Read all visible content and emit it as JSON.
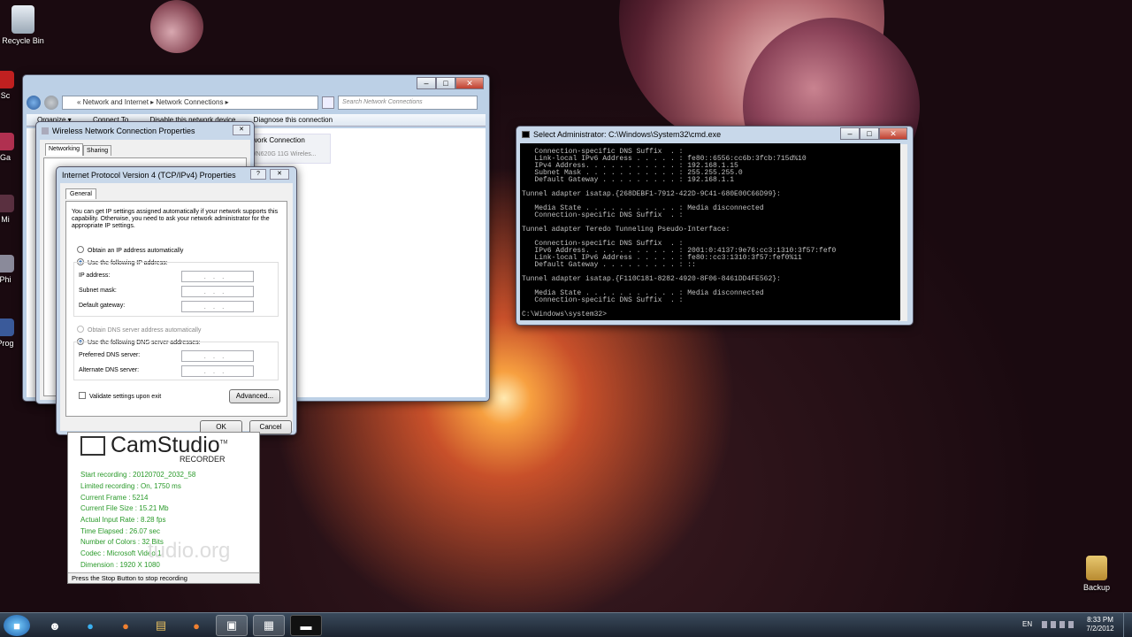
{
  "desktop": {
    "recycle_bin": "Recycle Bin",
    "backup": "Backup",
    "side_labels": [
      "Sc",
      "Ga",
      "Mi",
      "Phi",
      "Prog"
    ]
  },
  "explorer": {
    "breadcrumb": [
      "Network and Internet",
      "Network Connections"
    ],
    "search_placeholder": "Search Network Connections",
    "toolbar": [
      "Organize ▾",
      "Connect To",
      "Disable this network device",
      "Diagnose this connection"
    ],
    "item_name": "twork Connection",
    "item_detail": "WN620G 11G Wireles..."
  },
  "wnc_props": {
    "title": "Wireless Network Connection Properties",
    "tabs": [
      "Networking",
      "Sharing"
    ]
  },
  "ipv4": {
    "title": "Internet Protocol Version 4 (TCP/IPv4) Properties",
    "tab": "General",
    "intro": "You can get IP settings assigned automatically if your network supports this capability. Otherwise, you need to ask your network administrator for the appropriate IP settings.",
    "obtain_ip": "Obtain an IP address automatically",
    "use_ip": "Use the following IP address:",
    "ip_label": "IP address:",
    "mask_label": "Subnet mask:",
    "gateway_label": "Default gateway:",
    "obtain_dns": "Obtain DNS server address automatically",
    "use_dns": "Use the following DNS server addresses:",
    "pref_dns": "Preferred DNS server:",
    "alt_dns": "Alternate DNS server:",
    "validate": "Validate settings upon exit",
    "advanced": "Advanced...",
    "ok": "OK",
    "cancel": "Cancel",
    "field_dots": "...",
    "close_glyph": "✕",
    "help_glyph": "?"
  },
  "cmd": {
    "title": "Select Administrator: C:\\Windows\\System32\\cmd.exe",
    "output": "   Connection-specific DNS Suffix  . :\n   Link-local IPv6 Address . . . . . : fe80::6556:cc6b:3fcb:715d%10\n   IPv4 Address. . . . . . . . . . . : 192.168.1.15\n   Subnet Mask . . . . . . . . . . . : 255.255.255.0\n   Default Gateway . . . . . . . . . : 192.168.1.1\n\nTunnel adapter isatap.{268DEBF1-7912-422D-9C41-680E00C66D99}:\n\n   Media State . . . . . . . . . . . : Media disconnected\n   Connection-specific DNS Suffix  . :\n\nTunnel adapter Teredo Tunneling Pseudo-Interface:\n\n   Connection-specific DNS Suffix  . :\n   IPv6 Address. . . . . . . . . . . : 2001:0:4137:9e76:cc3:1310:3f57:fef0\n   Link-local IPv6 Address . . . . . : fe80::cc3:1310:3f57:fef0%11\n   Default Gateway . . . . . . . . . : ::\n\nTunnel adapter isatap.{F110C181-8282-4920-8F06-8461DD4FE562}:\n\n   Media State . . . . . . . . . . . : Media disconnected\n   Connection-specific DNS Suffix  . :\n\nC:\\Windows\\system32>"
  },
  "camstudio": {
    "logo": "CamStudio",
    "sub": "RECORDER",
    "tm": "TM",
    "lines": [
      "Start recording : 20120702_2032_58",
      "Limited recording : On, 1750 ms",
      "Current Frame : 5214",
      "Current File Size : 15.21 Mb",
      "Actual Input Rate : 8.28 fps",
      "Time Elapsed : 26.07 sec",
      "Number of Colors : 32 Bits",
      "Codec : Microsoft Video 1",
      "Dimension : 1920 X 1080"
    ],
    "watermark": "tudio.org",
    "status": "Press the Stop Button to stop recording"
  },
  "taskbar": {
    "lang": "EN",
    "time": "8:33 PM",
    "date": "7/2/2012"
  }
}
